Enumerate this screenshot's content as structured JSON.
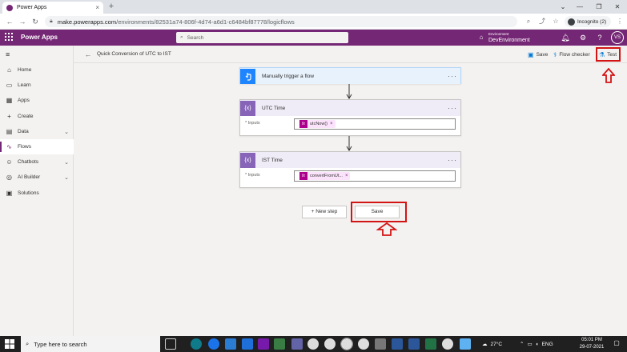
{
  "browser": {
    "tab_title": "Power Apps",
    "url_host": "make.powerapps.com",
    "url_path": "/environments/82531a74-806f-4d74-a6d1-c6484bf87778/logicflows",
    "profile_label": "Incognito (2)"
  },
  "app": {
    "brand": "Power Apps",
    "search_placeholder": "Search",
    "env_small": "Environment",
    "env_name": "DevEnvironment",
    "avatar_initials": "VS"
  },
  "sidebar": {
    "items": [
      {
        "label": "Home",
        "icon": "home-icon"
      },
      {
        "label": "Learn",
        "icon": "book-icon"
      },
      {
        "label": "Apps",
        "icon": "apps-icon"
      },
      {
        "label": "Create",
        "icon": "plus-icon"
      },
      {
        "label": "Data",
        "icon": "database-icon"
      },
      {
        "label": "Flows",
        "icon": "flow-icon"
      },
      {
        "label": "Chatbots",
        "icon": "chatbot-icon"
      },
      {
        "label": "AI Builder",
        "icon": "ai-builder-icon"
      },
      {
        "label": "Solutions",
        "icon": "solutions-icon"
      }
    ]
  },
  "command_bar": {
    "flow_name": "Quick Conversion of UTC to IST",
    "save": "Save",
    "flow_checker": "Flow checker",
    "test": "Test"
  },
  "flow": {
    "trigger": {
      "title": "Manually trigger a flow",
      "color": "#1f85ff"
    },
    "steps": [
      {
        "title": "UTC Time",
        "field_label": "* Inputs",
        "token": "utcNow()",
        "color": "#8764b8"
      },
      {
        "title": "IST Time",
        "field_label": "* Inputs",
        "token": "convertFromUt...",
        "color": "#8764b8"
      }
    ],
    "token_fx": "fx",
    "new_step": "+ New step",
    "save": "Save"
  },
  "taskbar": {
    "search_placeholder": "Type here to search",
    "weather": "27°C",
    "lang": "ENG",
    "time": "05:01 PM",
    "date": "29-07-2021"
  },
  "colors": {
    "brand": "#742774",
    "highlight": "#d31414",
    "trigger": "#1f85ff",
    "variable": "#8764b8"
  }
}
